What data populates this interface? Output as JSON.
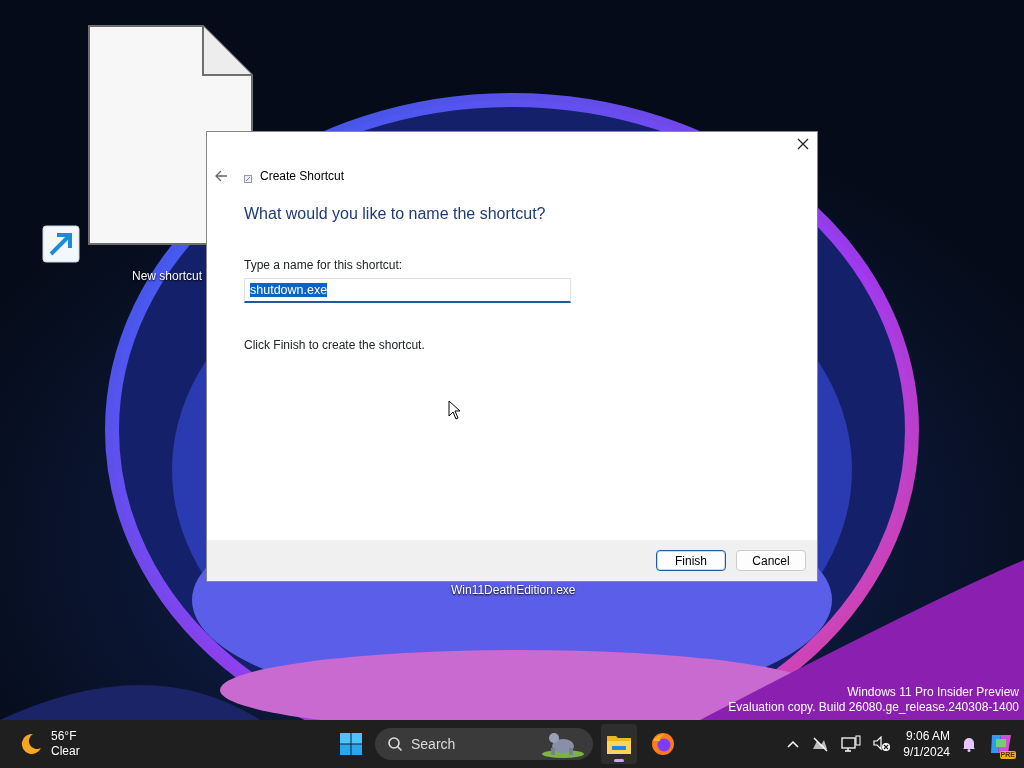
{
  "desktop": {
    "icons": [
      {
        "label": "New shortcut",
        "kind": "shortcut"
      },
      {
        "label": "Win11DeathEdition.exe",
        "kind": "exe"
      }
    ],
    "edition_notice": [
      "Windows 11 Pro Insider Preview",
      "Evaluation copy. Build 26080.ge_release.240308-1400"
    ]
  },
  "dialog": {
    "title": "Create Shortcut",
    "heading": "What would you like to name the shortcut?",
    "field_label": "Type a name for this shortcut:",
    "field_value": "shutdown.exe",
    "text_selected": true,
    "hint": "Click Finish to create the shortcut.",
    "buttons": [
      {
        "label": "Finish",
        "default": true
      },
      {
        "label": "Cancel",
        "default": false
      }
    ]
  },
  "taskbar": {
    "weather": {
      "temperature": "56°F",
      "condition": "Clear"
    },
    "search": {
      "placeholder": "Search"
    },
    "apps": [
      {
        "kind": "explorer",
        "running": true
      },
      {
        "kind": "firefox",
        "running": false
      }
    ],
    "clock": {
      "time": "9:06 AM",
      "date": "9/1/2024"
    },
    "copilot_badge": "PRE"
  }
}
